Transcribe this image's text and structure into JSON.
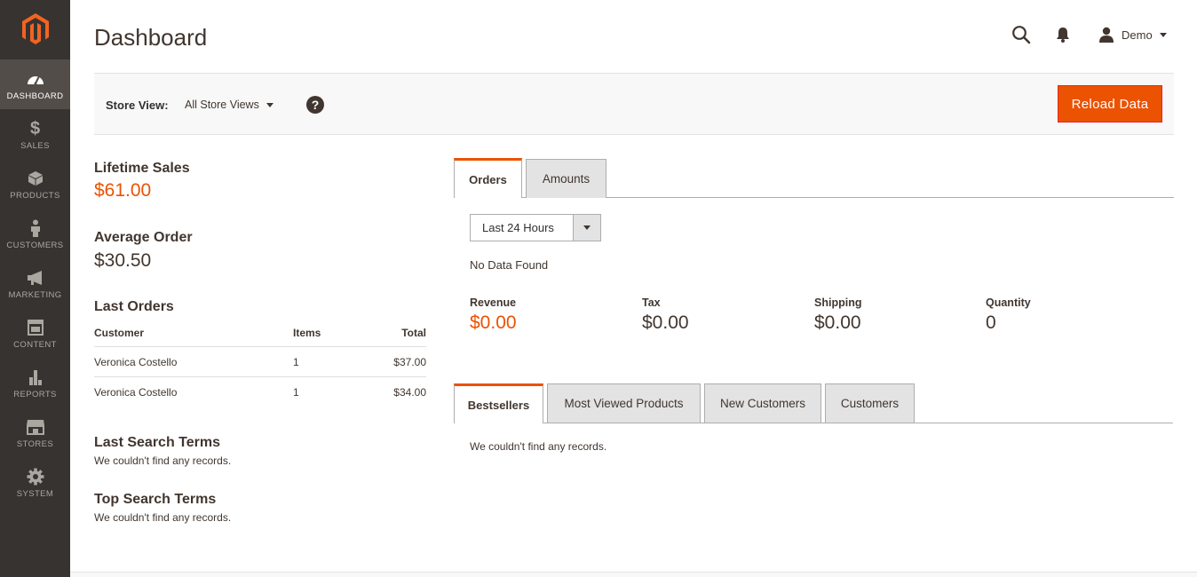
{
  "sidebar": {
    "items": [
      {
        "label": "Dashboard",
        "icon": "dashboard-icon",
        "active": true
      },
      {
        "label": "Sales",
        "icon": "dollar-icon"
      },
      {
        "label": "Products",
        "icon": "cube-icon"
      },
      {
        "label": "Customers",
        "icon": "person-icon"
      },
      {
        "label": "Marketing",
        "icon": "megaphone-icon"
      },
      {
        "label": "Content",
        "icon": "layout-icon"
      },
      {
        "label": "Reports",
        "icon": "bar-chart-icon"
      },
      {
        "label": "Stores",
        "icon": "storefront-icon"
      },
      {
        "label": "System",
        "icon": "gear-icon"
      }
    ]
  },
  "header": {
    "title": "Dashboard",
    "user_name": "Demo"
  },
  "toolbar": {
    "store_view_label": "Store View:",
    "store_view_value": "All Store Views",
    "help_glyph": "?",
    "reload_label": "Reload Data"
  },
  "lifetime_sales": {
    "title": "Lifetime Sales",
    "value": "$61.00"
  },
  "average_order": {
    "title": "Average Order",
    "value": "$30.50"
  },
  "last_orders": {
    "title": "Last Orders",
    "columns": [
      "Customer",
      "Items",
      "Total"
    ],
    "rows": [
      {
        "customer": "Veronica Costello",
        "items": "1",
        "total": "$37.00"
      },
      {
        "customer": "Veronica Costello",
        "items": "1",
        "total": "$34.00"
      }
    ]
  },
  "last_search_terms": {
    "title": "Last Search Terms",
    "empty": "We couldn't find any records."
  },
  "top_search_terms": {
    "title": "Top Search Terms",
    "empty": "We couldn't find any records."
  },
  "chart_tabs": {
    "tabs": [
      {
        "label": "Orders",
        "active": true
      },
      {
        "label": "Amounts"
      }
    ],
    "period": "Last 24 Hours",
    "no_data": "No Data Found"
  },
  "totals": [
    {
      "label": "Revenue",
      "value": "$0.00",
      "highlight": true
    },
    {
      "label": "Tax",
      "value": "$0.00"
    },
    {
      "label": "Shipping",
      "value": "$0.00"
    },
    {
      "label": "Quantity",
      "value": "0"
    }
  ],
  "grid_tabs": {
    "tabs": [
      {
        "label": "Bestsellers",
        "active": true
      },
      {
        "label": "Most Viewed Products"
      },
      {
        "label": "New Customers"
      },
      {
        "label": "Customers"
      }
    ],
    "empty": "We couldn't find any records."
  },
  "colors": {
    "accent": "#eb5202",
    "sidebar_bg": "#373330",
    "sidebar_active": "#524d49"
  }
}
